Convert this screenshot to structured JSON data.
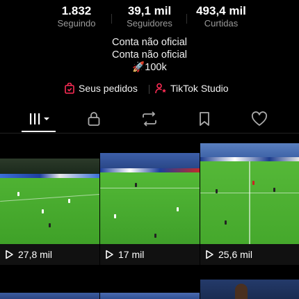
{
  "stats": [
    {
      "value": "1.832",
      "label": "Seguindo"
    },
    {
      "value": "39,1 mil",
      "label": "Seguidores"
    },
    {
      "value": "493,4 mil",
      "label": "Curtidas"
    }
  ],
  "bio": {
    "line1": "Conta não oficial",
    "line2": "Conta não oficial",
    "line3": "🚀100k"
  },
  "links": {
    "orders": "Seus pedidos",
    "studio": "TikTok Studio"
  },
  "tabs": [
    "videos-grid",
    "private",
    "reposts",
    "favorites",
    "liked"
  ],
  "videos": [
    {
      "views": "27,8 mil"
    },
    {
      "views": "17 mil"
    },
    {
      "views": "25,6 mil"
    }
  ],
  "colors": {
    "accent": "#fe2c55",
    "pitch": "#4caf2e",
    "muted": "#9a9a9a"
  }
}
